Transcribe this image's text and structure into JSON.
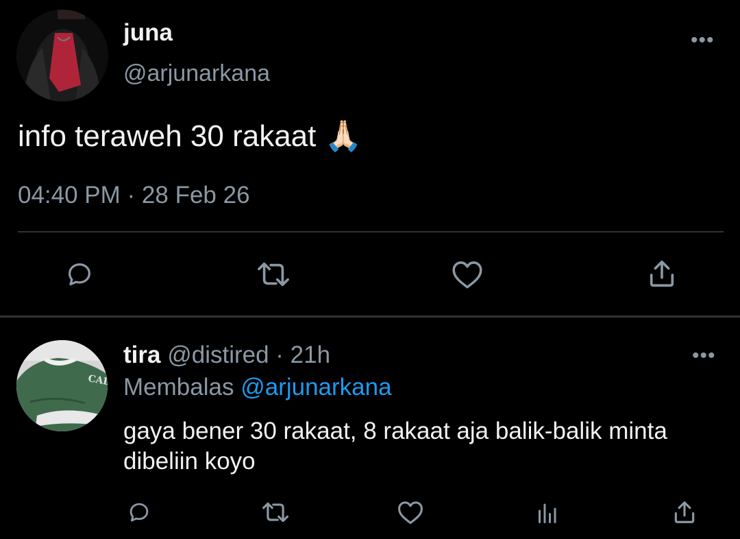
{
  "main_tweet": {
    "author_name": "juna",
    "author_handle": "@arjunarkana",
    "more_label": "•••",
    "text": "info teraweh 30 rakaat 🙏🏻",
    "timestamp": "04:40 PM · 28 Feb 26",
    "actions": [
      "reply-icon",
      "retweet-icon",
      "like-icon",
      "share-icon"
    ]
  },
  "reply": {
    "author_name": "tira",
    "author_handle": "@distired",
    "time": "· 21h",
    "more_label": "•••",
    "replying_prefix": "Membalas",
    "replying_mention": "@arjunarkana",
    "text": "gaya bener 30 rakaat, 8 rakaat aja balik-balik minta dibeliin koyo",
    "actions": [
      "reply-icon",
      "retweet-icon",
      "like-icon",
      "analytics-icon",
      "share-icon"
    ],
    "avatar_text": "CALIF"
  },
  "colors": {
    "background": "#000000",
    "text_primary": "#f2f2f2",
    "text_secondary": "#8b98a5",
    "accent": "#1d9bf0",
    "divider": "#2f3336"
  }
}
